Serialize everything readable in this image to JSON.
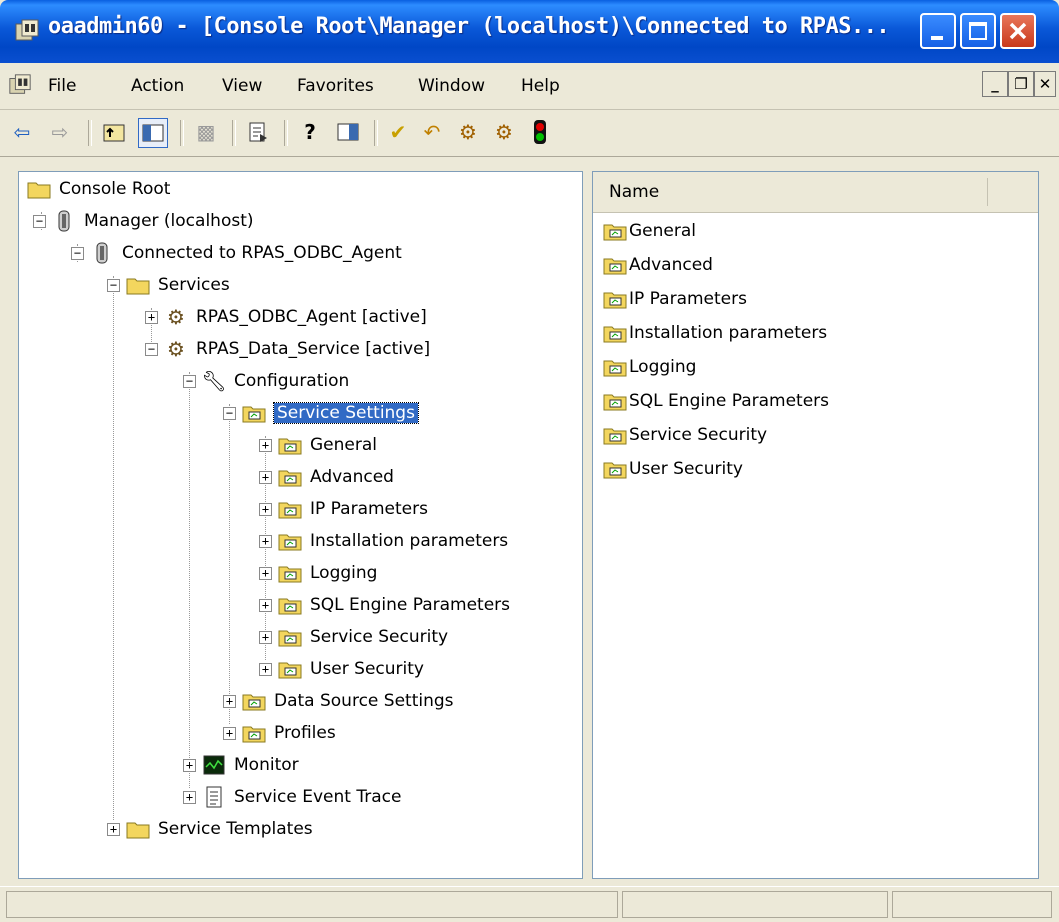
{
  "window": {
    "title": "oaadmin60 - [Console Root\\Manager (localhost)\\Connected to RPAS..."
  },
  "menu": {
    "items": [
      "File",
      "Action",
      "View",
      "Favorites",
      "Window",
      "Help"
    ]
  },
  "tree": {
    "root": "Console Root",
    "manager": "Manager (localhost)",
    "connected": "Connected to RPAS_ODBC_Agent",
    "services": "Services",
    "agent_service": "RPAS_ODBC_Agent [active]",
    "data_service": "RPAS_Data_Service [active]",
    "configuration": "Configuration",
    "service_settings": "Service Settings",
    "settings_children": [
      "General",
      "Advanced",
      "IP Parameters",
      "Installation parameters",
      "Logging",
      "SQL Engine Parameters",
      "Service Security",
      "User Security"
    ],
    "data_source_settings": "Data Source Settings",
    "profiles": "Profiles",
    "monitor": "Monitor",
    "event_trace": "Service Event Trace",
    "service_templates": "Service Templates"
  },
  "list": {
    "column": "Name",
    "items": [
      "General",
      "Advanced",
      "IP Parameters",
      "Installation parameters",
      "Logging",
      "SQL Engine Parameters",
      "Service Security",
      "User Security"
    ]
  },
  "colors": {
    "selection": "#316ac5",
    "titlebar": "#0a58d8",
    "folder": "#f3d65e"
  }
}
